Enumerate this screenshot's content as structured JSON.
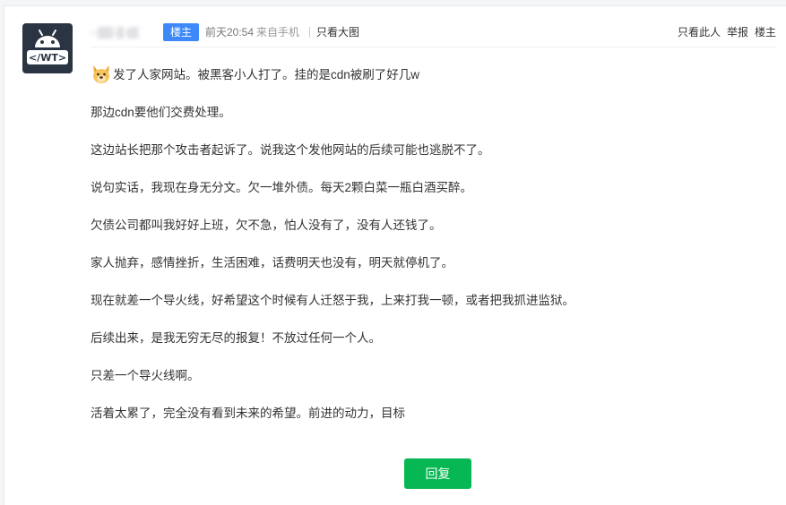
{
  "post": {
    "author": {
      "name_visible": ".[1]",
      "name_blurred": "··▒▒·▒ (▒",
      "avatar_text": "</WT>",
      "avatar_icon": "android-robot-icon"
    },
    "badge": "楼主",
    "time": "前天20:54",
    "source": "来自手机",
    "only_image": "只看大图",
    "actions": [
      "只看此人",
      "举报",
      "楼主"
    ],
    "paragraphs": [
      "发了人家网站。被黑客小人打了。挂的是cdn被刷了好几w",
      "那边cdn要他们交费处理。",
      "这边站长把那个攻击者起诉了。说我这个发他网站的后续可能也逃脱不了。",
      "说句实话，我现在身无分文。欠一堆外债。每天2颗白菜一瓶白酒买醉。",
      "欠债公司都叫我好好上班，欠不急，怕人没有了，没有人还钱了。",
      "家人抛弃，感情挫折，生活困难，话费明天也没有，明天就停机了。",
      "现在就差一个导火线，好希望这个时候有人迁怒于我，上来打我一顿，或者把我抓进监狱。",
      "后续出来，是我无穷无尽的报复！不放过任何一个人。",
      "只差一个导火线啊。",
      "活着太累了，完全没有看到未来的希望。前进的动力，目标"
    ],
    "emoji": "doge-emoji-icon",
    "reply_label": "回复"
  },
  "colors": {
    "badge_bg": "#3e89fa",
    "reply_bg": "#07b753",
    "avatar_bg": "#2b3442"
  }
}
